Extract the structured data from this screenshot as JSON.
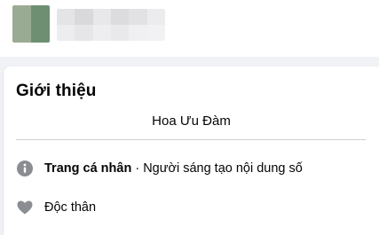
{
  "intro": {
    "title": "Giới thiệu",
    "bio": "Hoa Ưu Đàm",
    "items": [
      {
        "icon": "info-icon",
        "label": "Trang cá nhân",
        "separator": " · ",
        "value": "Người sáng tạo nội dung số"
      },
      {
        "icon": "heart-icon",
        "label": "Độc thân"
      }
    ]
  },
  "colors": {
    "icon": "#8a8d91",
    "divider": "#ced0d4",
    "background": "#f0f2f5"
  }
}
